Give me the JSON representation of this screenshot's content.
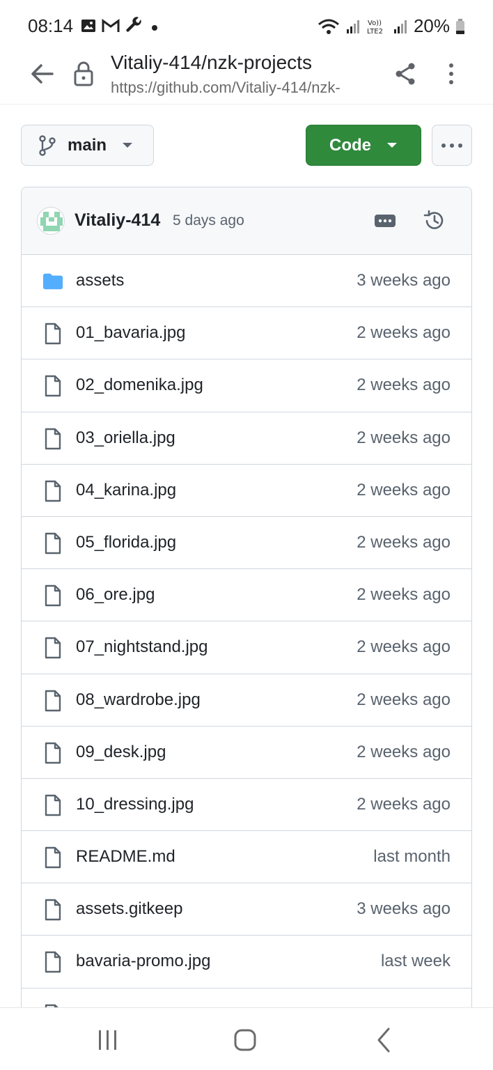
{
  "status_bar": {
    "time": "08:14",
    "battery": "20%",
    "icons": [
      "image-icon",
      "gmail-icon",
      "wrench-icon",
      "dot-icon",
      "wifi-icon",
      "signal-icon",
      "volte-icon",
      "signal-icon",
      "battery-icon"
    ]
  },
  "browser": {
    "title": "Vitaliy-414/nzk-projects",
    "url": "https://github.com/Vitaliy-414/nzk-projects",
    "url_display": "https://github.com/Vitaliy-414/nzk-"
  },
  "toolbar": {
    "branch": "main",
    "code_label": "Code"
  },
  "commit": {
    "author": "Vitaliy-414",
    "time": "5 days ago"
  },
  "files": [
    {
      "name": "assets",
      "time": "3 weeks ago",
      "type": "folder"
    },
    {
      "name": "01_bavaria.jpg",
      "time": "2 weeks ago",
      "type": "file"
    },
    {
      "name": "02_domenika.jpg",
      "time": "2 weeks ago",
      "type": "file"
    },
    {
      "name": "03_oriella.jpg",
      "time": "2 weeks ago",
      "type": "file"
    },
    {
      "name": "04_karina.jpg",
      "time": "2 weeks ago",
      "type": "file"
    },
    {
      "name": "05_florida.jpg",
      "time": "2 weeks ago",
      "type": "file"
    },
    {
      "name": "06_ore.jpg",
      "time": "2 weeks ago",
      "type": "file"
    },
    {
      "name": "07_nightstand.jpg",
      "time": "2 weeks ago",
      "type": "file"
    },
    {
      "name": "08_wardrobe.jpg",
      "time": "2 weeks ago",
      "type": "file"
    },
    {
      "name": "09_desk.jpg",
      "time": "2 weeks ago",
      "type": "file"
    },
    {
      "name": "10_dressing.jpg",
      "time": "2 weeks ago",
      "type": "file"
    },
    {
      "name": "README.md",
      "time": "last month",
      "type": "file"
    },
    {
      "name": "assets.gitkeep",
      "time": "3 weeks ago",
      "type": "file"
    },
    {
      "name": "bavaria-promo.jpg",
      "time": "last week",
      "type": "file"
    },
    {
      "name": "",
      "time": "",
      "type": "file"
    }
  ],
  "colors": {
    "code_button": "#2f8a3c",
    "folder": "#54aeff",
    "border": "#d0d7de",
    "header_bg": "#f6f8fa"
  }
}
